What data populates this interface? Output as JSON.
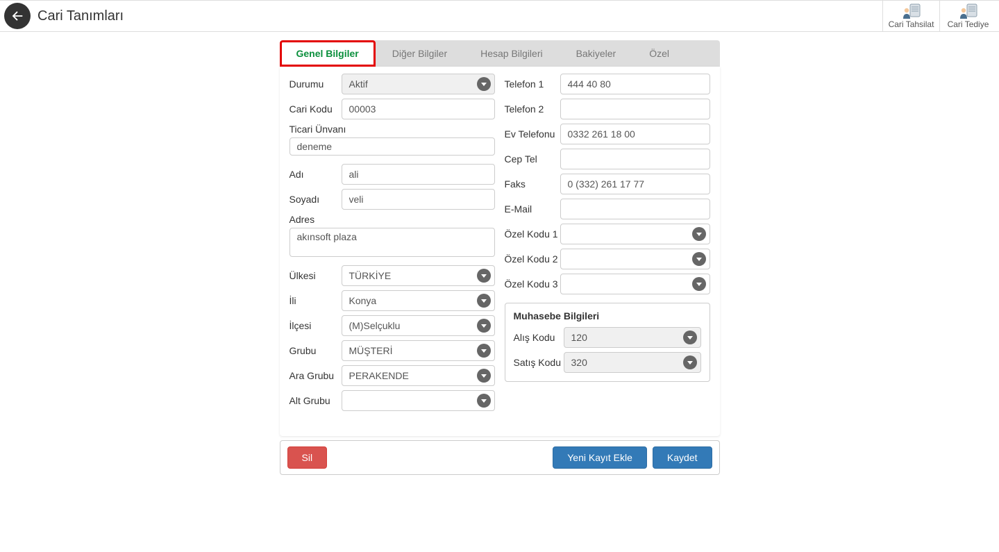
{
  "header": {
    "title": "Cari Tanımları",
    "actions": {
      "tahsilat": "Cari Tahsilat",
      "tediye": "Cari Tediye"
    }
  },
  "tabs": {
    "genel": "Genel Bilgiler",
    "diger": "Diğer Bilgiler",
    "hesap": "Hesap Bilgileri",
    "bakiyeler": "Bakiyeler",
    "ozel": "Özel"
  },
  "left": {
    "durumu_label": "Durumu",
    "durumu_value": "Aktif",
    "cari_kodu_label": "Cari Kodu",
    "cari_kodu_value": "00003",
    "ticari_unvani_label": "Ticari Ünvanı",
    "ticari_unvani_value": "deneme",
    "adi_label": "Adı",
    "adi_value": "ali",
    "soyadi_label": "Soyadı",
    "soyadi_value": "veli",
    "adres_label": "Adres",
    "adres_value": "akınsoft plaza",
    "ulkesi_label": "Ülkesi",
    "ulkesi_value": "TÜRKİYE",
    "ili_label": "İli",
    "ili_value": "Konya",
    "ilcesi_label": "İlçesi",
    "ilcesi_value": "(M)Selçuklu",
    "grubu_label": "Grubu",
    "grubu_value": "MÜŞTERİ",
    "ara_grubu_label": "Ara Grubu",
    "ara_grubu_value": "PERAKENDE",
    "alt_grubu_label": "Alt Grubu",
    "alt_grubu_value": ""
  },
  "right": {
    "telefon1_label": "Telefon 1",
    "telefon1_value": "444 40 80",
    "telefon2_label": "Telefon 2",
    "telefon2_value": "",
    "ev_tel_label": "Ev Telefonu",
    "ev_tel_value": "0332 261 18 00",
    "cep_tel_label": "Cep Tel",
    "cep_tel_value": "",
    "faks_label": "Faks",
    "faks_value": "0 (332) 261 17 77",
    "email_label": "E-Mail",
    "email_value": "",
    "ozel1_label": "Özel Kodu 1",
    "ozel1_value": "",
    "ozel2_label": "Özel Kodu 2",
    "ozel2_value": "",
    "ozel3_label": "Özel Kodu 3",
    "ozel3_value": "",
    "muhasebe_title": "Muhasebe Bilgileri",
    "alis_kodu_label": "Alış Kodu",
    "alis_kodu_value": "120",
    "satis_kodu_label": "Satış Kodu",
    "satis_kodu_value": "320"
  },
  "footer": {
    "sil": "Sil",
    "yeni": "Yeni Kayıt Ekle",
    "kaydet": "Kaydet"
  }
}
